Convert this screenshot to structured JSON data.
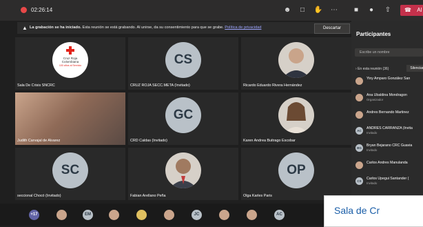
{
  "topbar": {
    "timer": "02:26:14",
    "leave_label": "Al"
  },
  "banner": {
    "bold": "La grabación se ha iniciado.",
    "text": " Esta reunión se está grabando. Al unirse, da su consentimiento para que se grabe. ",
    "link": "Política de privacidad",
    "dismiss": "Descartar"
  },
  "tiles": [
    {
      "label": "Sala De Crisis SNCRC",
      "logo": [
        "Cruz Roja",
        "Colombiana",
        "100 años al Servicio"
      ]
    },
    {
      "label": "CRUZ ROJA SECC.META (Invitado)",
      "initials": "CS"
    },
    {
      "label": "Ricardo Eduardo Rivera Hernández"
    },
    {
      "label": "Judith Carvajal de Alvarez"
    },
    {
      "label": "CRD Caldas (Invitado)",
      "initials": "GC"
    },
    {
      "label": "Karen Andrea Buitrago Escobar"
    },
    {
      "label": "seccional Chocó (Invitado)",
      "initials": "SC"
    },
    {
      "label": "Fabian Arellano Peña"
    },
    {
      "label": "Olga Karles Paris",
      "initials": "OP"
    }
  ],
  "panel": {
    "title": "Participantes",
    "search_placeholder": "Escribe un nombre",
    "section": "En esta reunión (36)",
    "mute_all": "Silenciar",
    "items": [
      {
        "name": "Yiny Amparo González San",
        "role": ""
      },
      {
        "name": "Ana Ubaldina Mondragon",
        "role": "Organizador"
      },
      {
        "name": "Andres Bernando Martinez",
        "role": ""
      },
      {
        "name": "ANDRES CARRANZA (Invita",
        "role": "Invitado",
        "initials": "AC"
      },
      {
        "name": "Bryan Bejarano CRC Guavia",
        "role": "Invitado",
        "initials": "BG"
      },
      {
        "name": "Carlos Andres Manulanda",
        "role": ""
      },
      {
        "name": "Carlos Upegui Santander (",
        "role": "Invitado",
        "initials": "CS"
      }
    ]
  },
  "bottombar": {
    "more": "+17",
    "avatars": [
      "",
      "EM",
      "",
      "",
      "",
      "JC",
      "",
      "",
      "AC",
      ""
    ]
  },
  "caption": "Sala de Cr"
}
